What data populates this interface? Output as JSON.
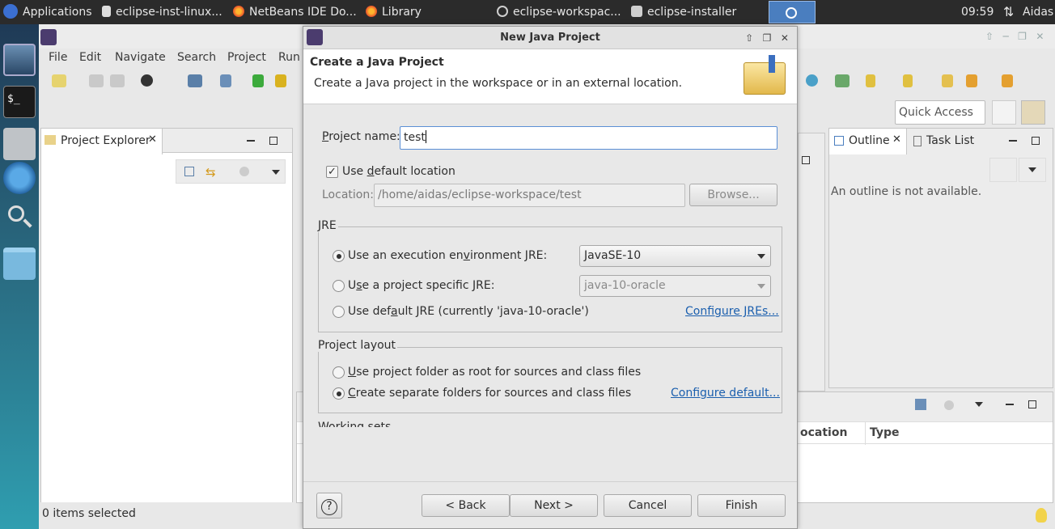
{
  "taskbar": {
    "applications": "Applications",
    "tasks": [
      "eclipse-inst-linux...",
      "NetBeans IDE Do...",
      "Library",
      "eclipse-workspac...",
      "eclipse-installer"
    ],
    "clock": "09:59",
    "user": "Aidas"
  },
  "eclipse": {
    "menu": [
      "File",
      "Edit",
      "Navigate",
      "Search",
      "Project",
      "Run"
    ],
    "quick_access": "Quick Access",
    "project_explorer_tab": "Project Explorer",
    "outline_tab": "Outline",
    "task_list_tab": "Task List",
    "outline_message": "An outline is not available.",
    "status": "0 items selected",
    "table_headers": [
      "ocation",
      "Type"
    ]
  },
  "dialog": {
    "title": "New Java Project",
    "heading": "Create a Java Project",
    "description": "Create a Java project in the workspace or in an external location.",
    "project_name_label": "Project name:",
    "project_name_value": "test",
    "use_default_location_label": "Use default location",
    "use_default_location_checked": true,
    "location_label": "Location:",
    "location_value": "/home/aidas/eclipse-workspace/test",
    "browse": "Browse...",
    "jre_group": "JRE",
    "jre_exec_env_label": "Use an execution environment JRE:",
    "jre_exec_env_value": "JavaSE-10",
    "jre_specific_label": "Use a project specific JRE:",
    "jre_specific_value": "java-10-oracle",
    "jre_default_label": "Use default JRE (currently 'java-10-oracle')",
    "configure_jres": "Configure JREs...",
    "layout_group": "Project layout",
    "layout_root_label": "Use project folder as root for sources and class files",
    "layout_separate_label": "Create separate folders for sources and class files",
    "configure_default": "Configure default...",
    "working_sets_partial": "Working sets",
    "help": "?",
    "back": "< Back",
    "next": "Next >",
    "cancel": "Cancel",
    "finish": "Finish"
  },
  "colors": {
    "taskbar_bg": "#2b2b2b",
    "link": "#1b5fae",
    "focus_border": "#5b8fd6"
  }
}
